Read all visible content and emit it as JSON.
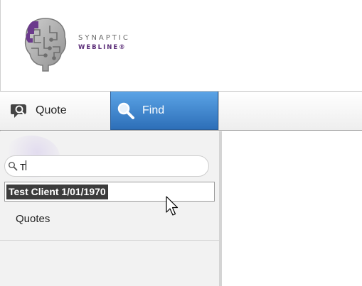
{
  "logo": {
    "line1": "SYNAPTIC",
    "line2": "WEBLINE®",
    "icon": "brain-icon"
  },
  "toolbar": {
    "quote_label": "Quote",
    "quote_icon": "speech-bubble-search-icon",
    "find_label": "Find",
    "find_icon": "magnifier-icon",
    "active_tab": "Find",
    "active_color": "#3a82cf"
  },
  "search": {
    "value": "T",
    "icon": "search-icon"
  },
  "suggestions": [
    "Test Client 1/01/1970"
  ],
  "panel": {
    "items": [
      {
        "label": "Quotes"
      }
    ]
  },
  "pointer": "arrow-cursor-icon"
}
